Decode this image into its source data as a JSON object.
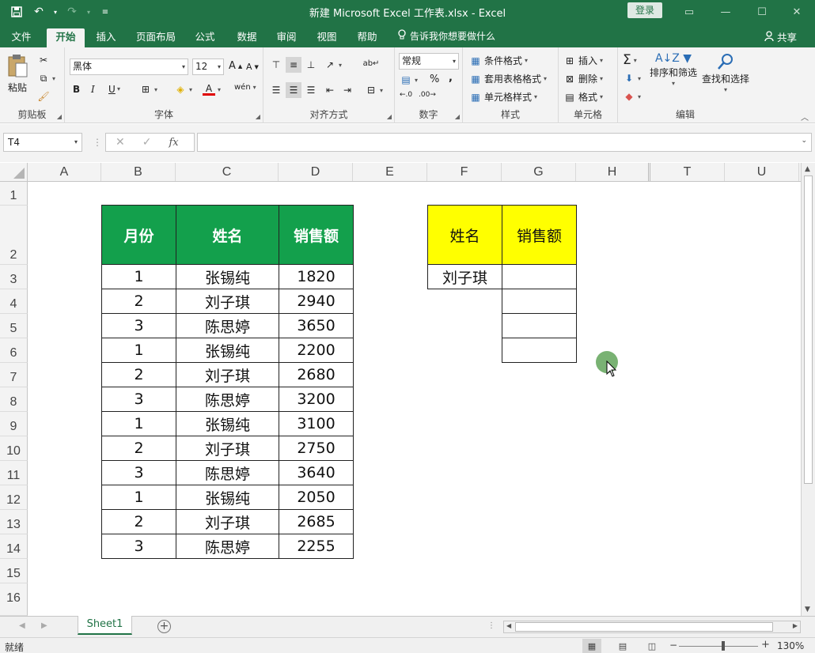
{
  "window": {
    "title": "新建 Microsoft Excel 工作表.xlsx  -  Excel",
    "signin_label": "登录"
  },
  "tabs": [
    "文件",
    "开始",
    "插入",
    "页面布局",
    "公式",
    "数据",
    "审阅",
    "视图",
    "帮助"
  ],
  "active_tab": "开始",
  "tell_me": "告诉我你想要做什么",
  "share_label": "共享",
  "ribbon": {
    "clipboard": {
      "paste_label": "粘贴",
      "group_label": "剪贴板"
    },
    "font": {
      "font_name": "黑体",
      "font_size": "12",
      "bold": "B",
      "italic": "I",
      "underline": "U",
      "group_label": "字体"
    },
    "alignment": {
      "group_label": "对齐方式"
    },
    "number": {
      "format": "常规",
      "percent": "%",
      "comma": ",",
      "group_label": "数字"
    },
    "styles": {
      "conditional": "条件格式",
      "table": "套用表格格式",
      "cell_styles": "单元格样式",
      "group_label": "样式"
    },
    "cells": {
      "insert": "插入",
      "delete": "删除",
      "format": "格式",
      "group_label": "单元格"
    },
    "editing": {
      "sort_filter": "排序和筛选",
      "find_select": "查找和选择",
      "group_label": "编辑"
    }
  },
  "formula_bar": {
    "name_box": "T4",
    "formula": ""
  },
  "columns": [
    "A",
    "B",
    "C",
    "D",
    "E",
    "F",
    "G",
    "H",
    "T",
    "U"
  ],
  "rows": [
    "1",
    "2",
    "3",
    "4",
    "5",
    "6",
    "7",
    "8",
    "9",
    "10",
    "11",
    "12",
    "13",
    "14",
    "15",
    "16"
  ],
  "sales_table": {
    "headers": [
      "月份",
      "姓名",
      "销售额"
    ],
    "rows": [
      [
        "1",
        "张锡纯",
        "1820"
      ],
      [
        "2",
        "刘子琪",
        "2940"
      ],
      [
        "3",
        "陈思婷",
        "3650"
      ],
      [
        "1",
        "张锡纯",
        "2200"
      ],
      [
        "2",
        "刘子琪",
        "2680"
      ],
      [
        "3",
        "陈思婷",
        "3200"
      ],
      [
        "1",
        "张锡纯",
        "3100"
      ],
      [
        "2",
        "刘子琪",
        "2750"
      ],
      [
        "3",
        "陈思婷",
        "3640"
      ],
      [
        "1",
        "张锡纯",
        "2050"
      ],
      [
        "2",
        "刘子琪",
        "2685"
      ],
      [
        "3",
        "陈思婷",
        "2255"
      ]
    ],
    "header_color": "#13a04c"
  },
  "lookup_table": {
    "headers": [
      "姓名",
      "销售额"
    ],
    "name_value": "刘子琪",
    "header_color": "#ffff00"
  },
  "sheet_tab": "Sheet1",
  "status": {
    "ready": "就绪",
    "zoom": "130%"
  }
}
